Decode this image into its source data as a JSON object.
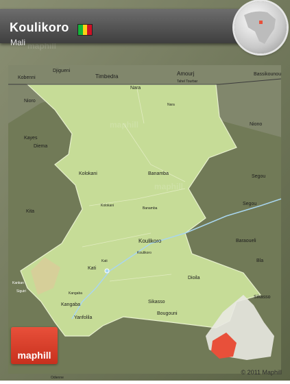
{
  "header": {
    "title": "Koulikoro",
    "subtitle": "Mali",
    "flag_colors": [
      "#14b53a",
      "#fcd116",
      "#ce1126"
    ]
  },
  "colors": {
    "region_fill": "#c6dc97",
    "surround_fill": "#6b7452",
    "rivers": "#a9d6f0",
    "highlight": "#e8503a"
  },
  "labels": {
    "kobenni": "Kobenni",
    "djiguení": "Djigueni",
    "timbedra": "Timbedra",
    "amourj": "Amourj",
    "bassikounou": "Bassikounou",
    "tahe": "Tahel Tourbar",
    "nara": "Nara",
    "nioro": "Nioro",
    "niono": "Niono",
    "kayes": "Kayes",
    "diema": "Diema",
    "nara_small": "Nara",
    "kolokani": "Kolokani",
    "banamba": "Banamba",
    "segou": "Segou",
    "segou_small": "Segou",
    "kita": "Kita",
    "kolokani_small": "Kolokani",
    "banamba_small": "Banamba",
    "koulikoro": "Koulikoro",
    "koulikoro_small": "Koulikoro",
    "baraoueli": "Baraoueli",
    "kati": "Kati",
    "kati_small": "Kati",
    "bla": "Bla",
    "dioila": "Dioila",
    "kangaba": "Kangaba",
    "sikasso": "Sikasso",
    "sikasso_right": "Sikasso",
    "yanfolila": "Yanfolila",
    "bougouni": "Bougouni",
    "kankan": "Kankan",
    "siguiri": "Siguiri",
    "kangaba_small": "Kangaba",
    "odienne": "Odienne"
  },
  "logo_text": "maphill",
  "copyright": "© 2011 Maphill"
}
